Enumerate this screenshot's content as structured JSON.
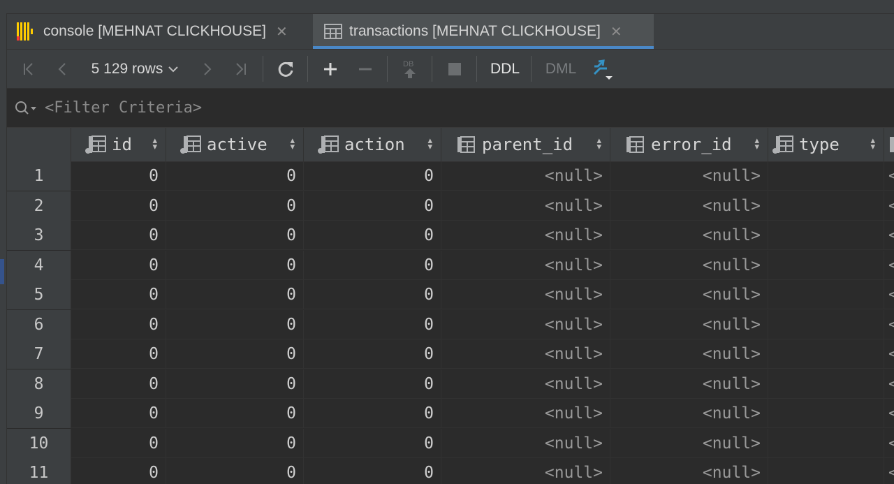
{
  "tabs": [
    {
      "label": "console [MEHNAT CLICKHOUSE]",
      "icon": "console-icon"
    },
    {
      "label": "transactions [MEHNAT CLICKHOUSE]",
      "icon": "table-icon"
    }
  ],
  "toolbar": {
    "rows_label": "5 129 rows",
    "ddl_label": "DDL",
    "dml_label": "DML"
  },
  "filter": {
    "placeholder": "<Filter Criteria>"
  },
  "columns": [
    "id",
    "active",
    "action",
    "parent_id",
    "error_id",
    "type"
  ],
  "rows": [
    {
      "n": "1",
      "id": "0",
      "active": "0",
      "action": "0",
      "parent_id": "<null>",
      "error_id": "<null>",
      "type": ""
    },
    {
      "n": "2",
      "id": "0",
      "active": "0",
      "action": "0",
      "parent_id": "<null>",
      "error_id": "<null>",
      "type": ""
    },
    {
      "n": "3",
      "id": "0",
      "active": "0",
      "action": "0",
      "parent_id": "<null>",
      "error_id": "<null>",
      "type": ""
    },
    {
      "n": "4",
      "id": "0",
      "active": "0",
      "action": "0",
      "parent_id": "<null>",
      "error_id": "<null>",
      "type": ""
    },
    {
      "n": "5",
      "id": "0",
      "active": "0",
      "action": "0",
      "parent_id": "<null>",
      "error_id": "<null>",
      "type": ""
    },
    {
      "n": "6",
      "id": "0",
      "active": "0",
      "action": "0",
      "parent_id": "<null>",
      "error_id": "<null>",
      "type": ""
    },
    {
      "n": "7",
      "id": "0",
      "active": "0",
      "action": "0",
      "parent_id": "<null>",
      "error_id": "<null>",
      "type": ""
    },
    {
      "n": "8",
      "id": "0",
      "active": "0",
      "action": "0",
      "parent_id": "<null>",
      "error_id": "<null>",
      "type": ""
    },
    {
      "n": "9",
      "id": "0",
      "active": "0",
      "action": "0",
      "parent_id": "<null>",
      "error_id": "<null>",
      "type": ""
    },
    {
      "n": "10",
      "id": "0",
      "active": "0",
      "action": "0",
      "parent_id": "<null>",
      "error_id": "<null>",
      "type": ""
    },
    {
      "n": "11",
      "id": "0",
      "active": "0",
      "action": "0",
      "parent_id": "<null>",
      "error_id": "<null>",
      "type": ""
    }
  ],
  "colors": {
    "accent": "#4a88c7",
    "clickhouse": "#ffcc00",
    "clickhouse_red": "#ff3b30"
  }
}
